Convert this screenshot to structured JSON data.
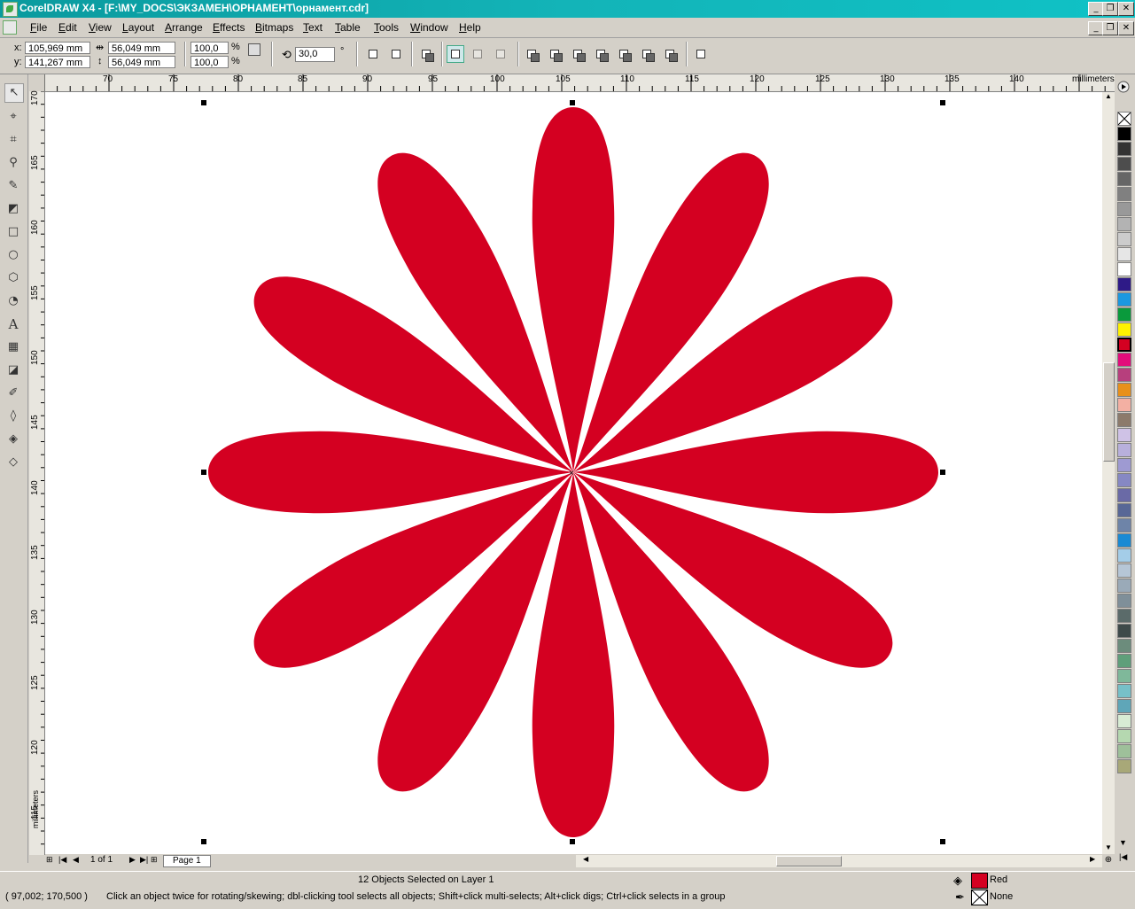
{
  "window": {
    "title": "CorelDRAW X4 - [F:\\MY_DOCS\\ЭКЗАМЕН\\ОРНАМЕНТ\\орнамент.cdr]",
    "min_icon": "minimize-icon",
    "restore_icon": "restore-icon",
    "close_icon": "close-icon"
  },
  "menu": [
    "File",
    "Edit",
    "View",
    "Layout",
    "Arrange",
    "Effects",
    "Bitmaps",
    "Text",
    "Table",
    "Tools",
    "Window",
    "Help"
  ],
  "property_bar": {
    "x_label": "x:",
    "x_value": "105,969 mm",
    "y_label": "y:",
    "y_value": "141,267 mm",
    "width_value": "56,049 mm",
    "height_value": "56,049 mm",
    "scale_x": "100,0",
    "scale_y": "100,0",
    "percent": "%",
    "rotation": "30,0",
    "degree": "°"
  },
  "ruler": {
    "h_ticks": [
      "70",
      "75",
      "80",
      "85",
      "90",
      "95",
      "100",
      "105",
      "110",
      "115",
      "120",
      "125",
      "130",
      "135",
      "140"
    ],
    "v_ticks": [
      "170",
      "165",
      "160",
      "155",
      "150",
      "145",
      "140",
      "135",
      "130",
      "125",
      "120",
      "115"
    ],
    "units": "millimeters"
  },
  "drawing": {
    "fill_color": "#d40021",
    "petal_count": 12
  },
  "page_nav": {
    "counter": "1 of 1",
    "page_tab": "Page 1"
  },
  "palette": [
    "#000000",
    "#333333",
    "#4d4d4d",
    "#666666",
    "#808080",
    "#999999",
    "#b3b3b3",
    "#cccccc",
    "#e6e6e6",
    "#ffffff",
    "#2e1a87",
    "#1b98e0",
    "#0a9a3c",
    "#fff200",
    "#d40021",
    "#e20c7b",
    "#b73f7d",
    "#e8901a",
    "#f3b0a3",
    "#8c7a6b",
    "#cfc2e6",
    "#b8b0dc",
    "#9e9ad2",
    "#8688c4",
    "#6a6aa6",
    "#586796",
    "#6e84a8",
    "#1a8ad4",
    "#a4cde8",
    "#b6c6d6",
    "#9aaab8",
    "#7f8f99",
    "#5b6b6a",
    "#3e4a4a",
    "#6c8c7c",
    "#5f9f7a",
    "#7fb89a",
    "#77c0c8",
    "#5fa6b8",
    "#d8ecd4",
    "#b5d8b0",
    "#9ec09a",
    "#a8a878"
  ],
  "status": {
    "coords": "( 97,002; 170,500 )",
    "selection": "12 Objects Selected on Layer 1",
    "hint": "Click an object twice for rotating/skewing; dbl-clicking tool selects all objects; Shift+click multi-selects; Alt+click digs; Ctrl+click selects in a group",
    "fill_name": "Red",
    "fill_color": "#d40021",
    "outline_name": "None"
  }
}
